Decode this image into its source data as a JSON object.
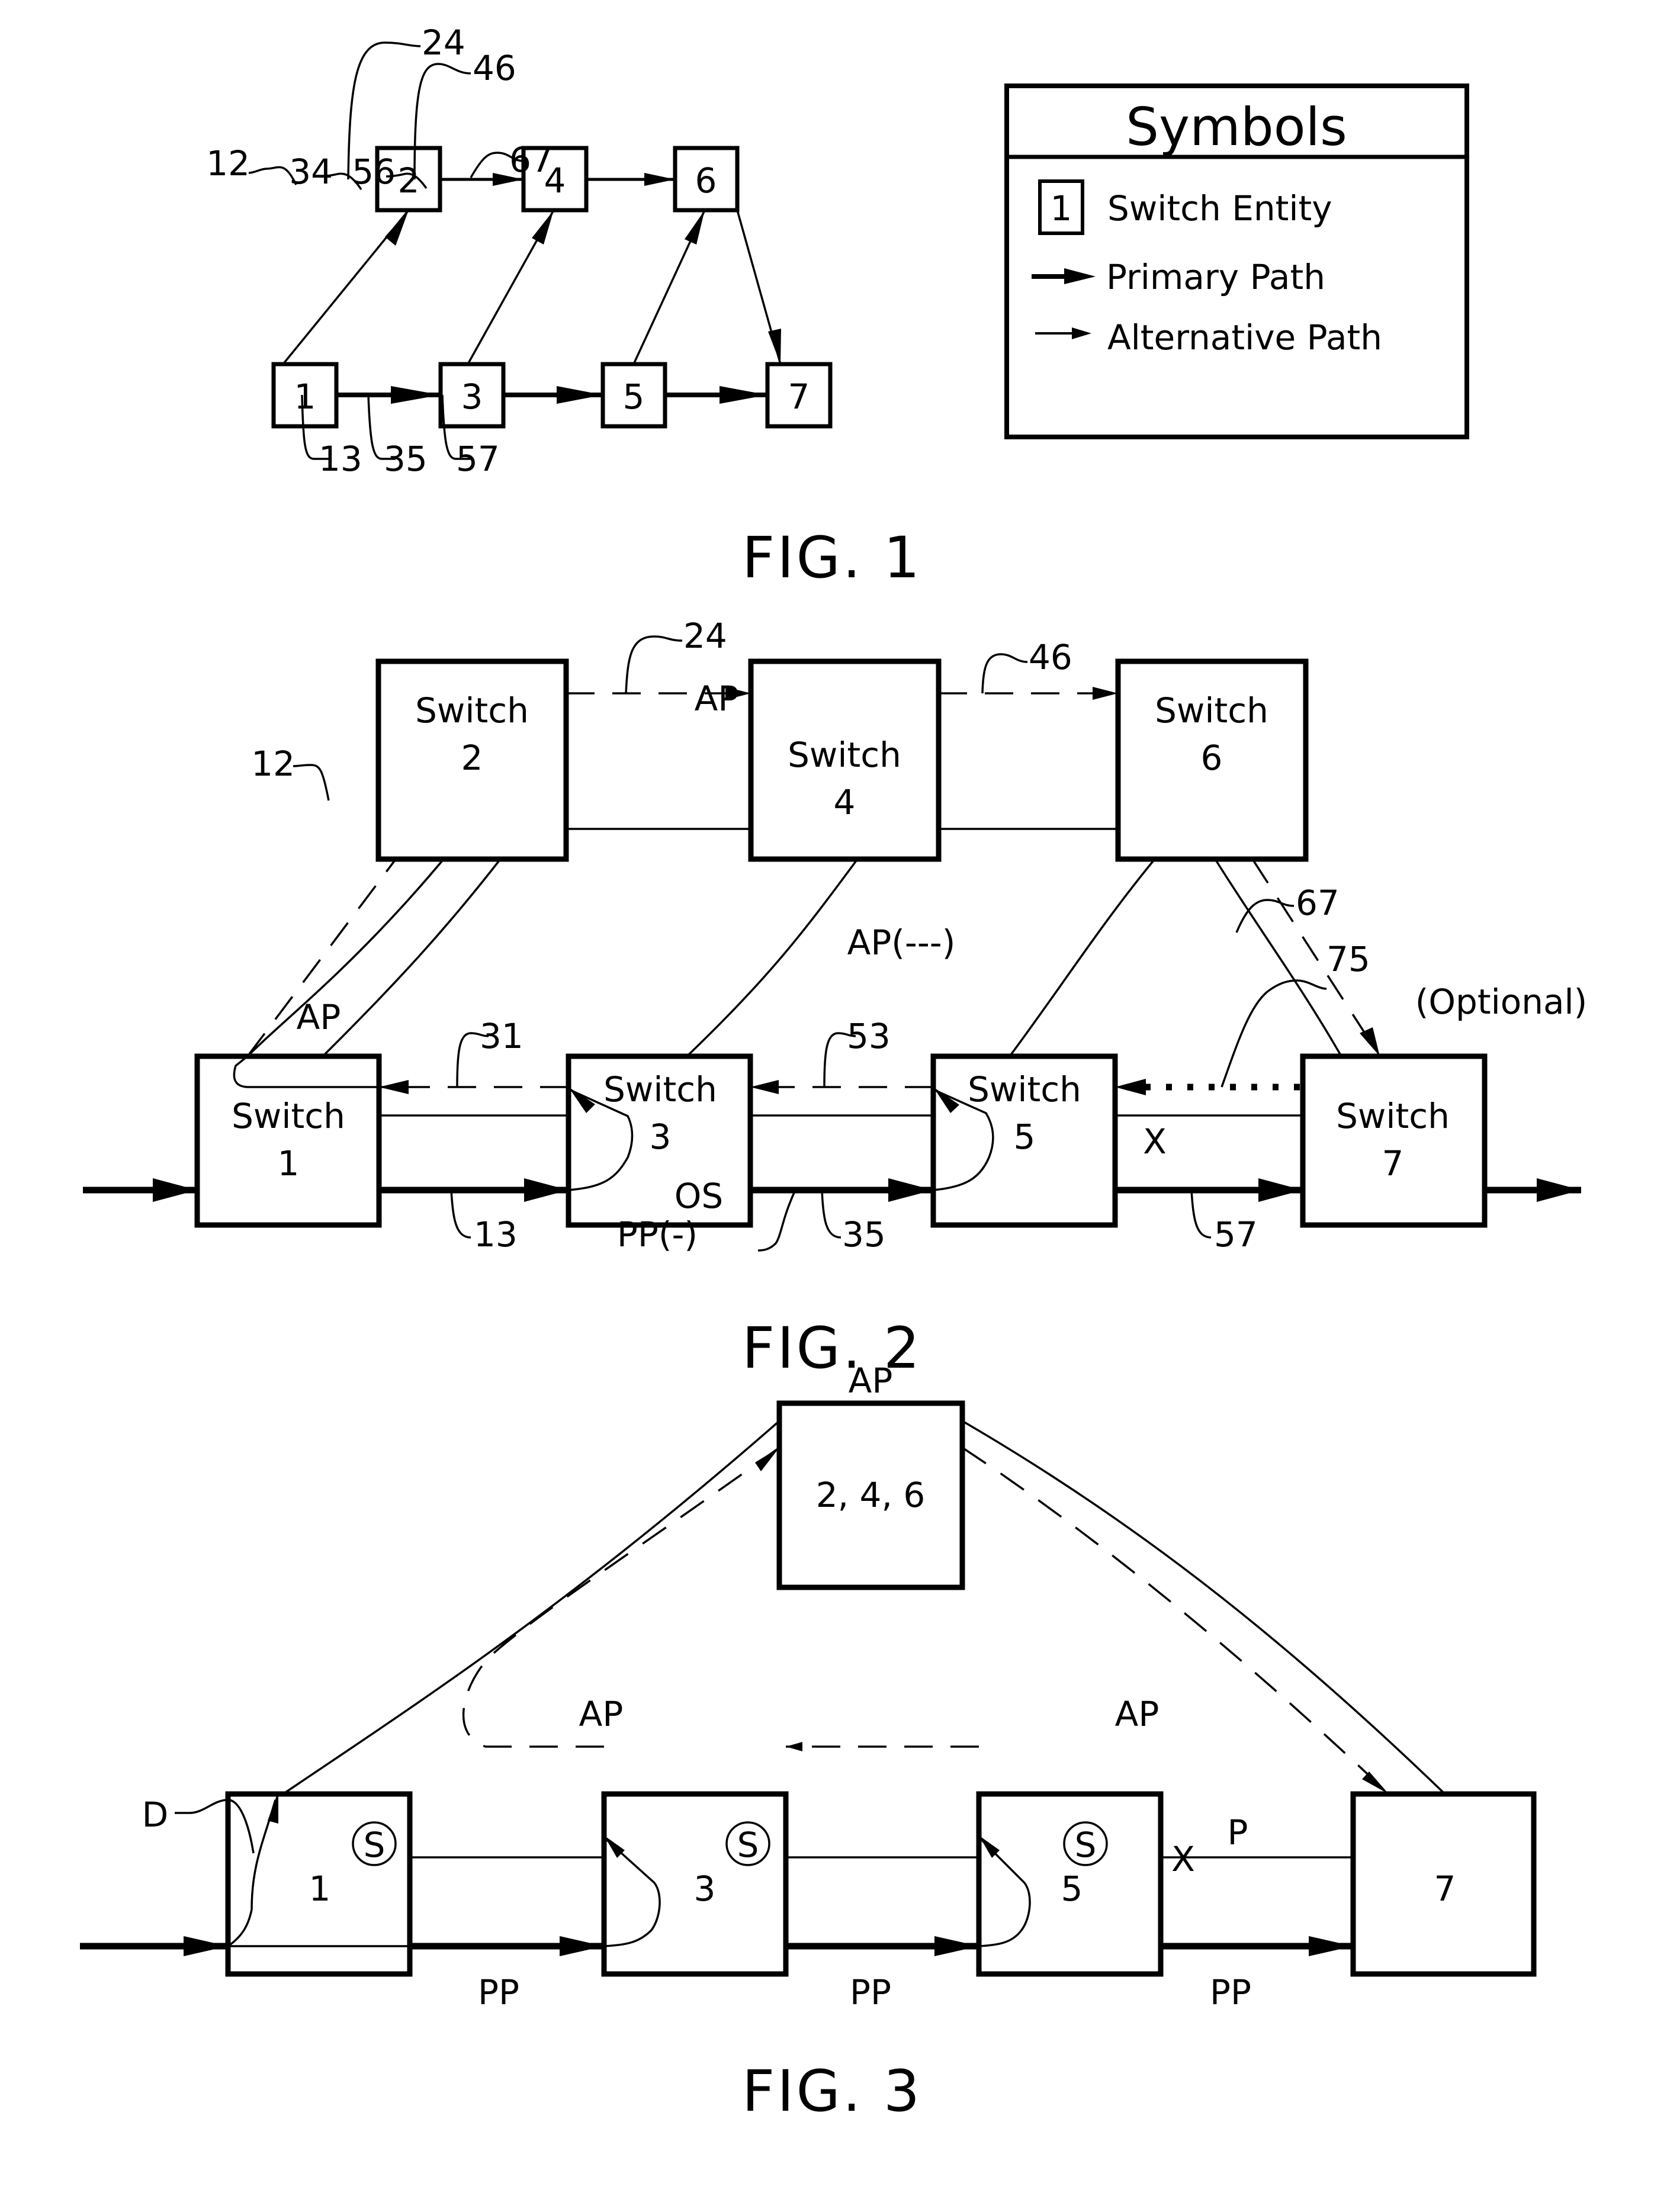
{
  "fig1": {
    "caption": "FIG. 1",
    "nodes": [
      "1",
      "2",
      "3",
      "4",
      "5",
      "6",
      "7"
    ],
    "refs": {
      "r12": "12",
      "r13": "13",
      "r24": "24",
      "r34": "34",
      "r35": "35",
      "r46": "46",
      "r56": "56",
      "r57": "57",
      "r67": "67"
    }
  },
  "symbols": {
    "title": "Symbols",
    "entity_num": "1",
    "entity_label": "Switch Entity",
    "primary_label": "Primary Path",
    "alternative_label": "Alternative Path"
  },
  "fig2": {
    "caption": "FIG. 2",
    "switch_word": "Switch",
    "nodes": [
      "1",
      "2",
      "3",
      "4",
      "5",
      "6",
      "7"
    ],
    "refs": {
      "r12": "12",
      "r13": "13",
      "r24": "24",
      "r31": "31",
      "r35": "35",
      "r46": "46",
      "r53": "53",
      "r57": "57",
      "r67": "67",
      "r75": "75"
    },
    "ap_top": "AP",
    "ap_left": "AP",
    "ap_legend": "AP(---)",
    "pp_legend": "PP(-)",
    "os_label": "OS",
    "optional_label": "(Optional)",
    "fail_mark": "X"
  },
  "fig3": {
    "caption": "FIG. 3",
    "ap_box_label": "2, 4, 6",
    "ap_top": "AP",
    "ap_left": "AP",
    "ap_right": "AP",
    "nodes": [
      "1",
      "3",
      "5",
      "7"
    ],
    "s_marker": "S",
    "d_label": "D",
    "p_label": "P",
    "fail_mark": "X",
    "pp_labels": [
      "PP",
      "PP",
      "PP"
    ]
  }
}
